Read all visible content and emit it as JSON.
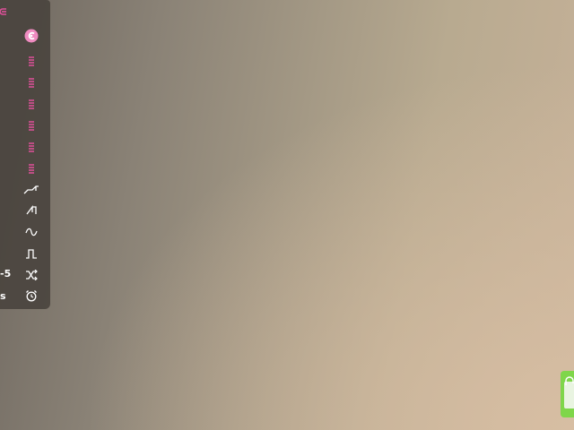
{
  "sidebar": {
    "items": [
      {
        "icon": "back-arrow-icon"
      },
      {
        "icon": "app-badge-icon"
      },
      {
        "icon": "list-icon"
      },
      {
        "icon": "list-icon"
      },
      {
        "icon": "list-icon"
      },
      {
        "icon": "list-icon"
      },
      {
        "icon": "list-icon"
      },
      {
        "icon": "list-icon"
      },
      {
        "icon": "ramp-wave-icon"
      },
      {
        "icon": "saw-wave-icon"
      },
      {
        "icon": "sine-wave-icon"
      },
      {
        "icon": "square-wave-icon"
      },
      {
        "icon": "shuffle-icon"
      },
      {
        "icon": "alarm-clock-icon"
      }
    ],
    "labels": {
      "shuffle_label": "-5",
      "alarm_label": "s"
    }
  },
  "colors": {
    "accent": "#e0509a",
    "sidebar_bg": "#48423c",
    "tray_green": "#7fd64a"
  }
}
